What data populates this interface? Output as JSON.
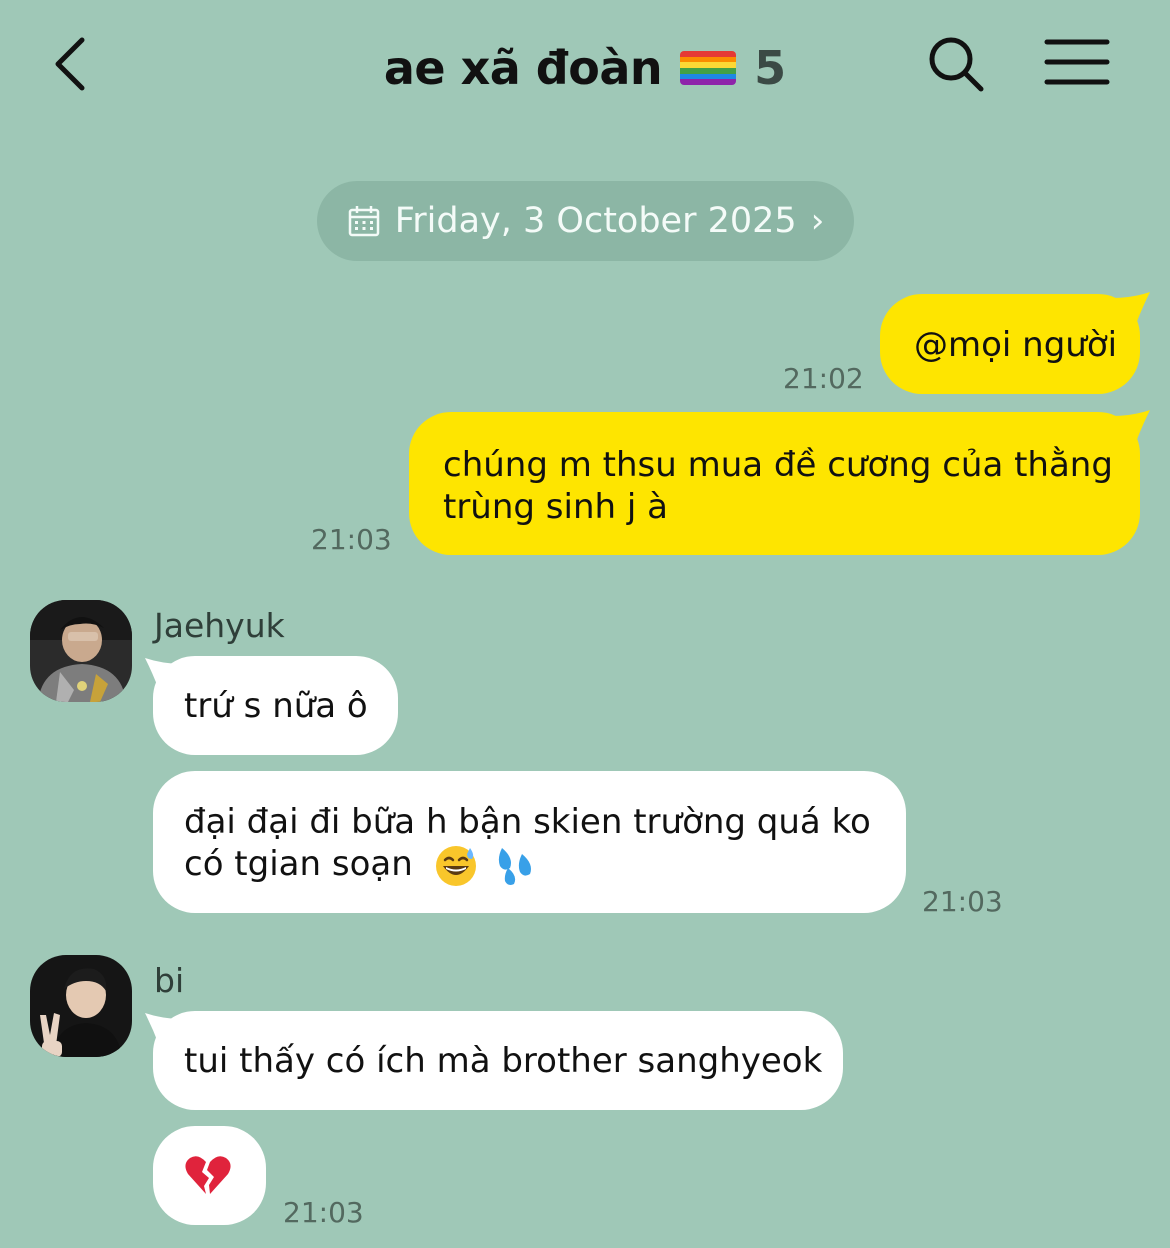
{
  "header": {
    "title": "ae xã đoàn",
    "member_count": "5",
    "back_icon": "chevron-left-icon",
    "search_icon": "search-icon",
    "menu_icon": "hamburger-menu-icon"
  },
  "date_divider": {
    "label": "Friday, 3 October 2025",
    "icon": "calendar-icon",
    "chevron": "›"
  },
  "messages": [
    {
      "sender": "me",
      "text": "@mọi người",
      "time": "21:02"
    },
    {
      "sender": "me",
      "lines": [
        "chúng m thsu mua đề cương của thằng",
        "trùng sinh j à"
      ],
      "time": "21:03"
    },
    {
      "sender": "Jaehyuk",
      "text": "trứ s nữa ô"
    },
    {
      "sender": "Jaehyuk",
      "lines": [
        "đại đại đi bữa h bận skien trường quá ko",
        "có tgian soạn"
      ],
      "emojis": [
        "grinning-sweat-emoji",
        "sweat-droplets-emoji"
      ],
      "time": "21:03"
    },
    {
      "sender": "bi",
      "text": "tui thấy có ích mà brother sanghyeok"
    },
    {
      "sender": "bi",
      "emoji": "broken-heart-emoji",
      "time": "21:03"
    }
  ],
  "colors": {
    "background": "#9fc8b7",
    "mine_bubble": "#fee500",
    "their_bubble": "#ffffff",
    "pill": "#8cb6a5"
  }
}
